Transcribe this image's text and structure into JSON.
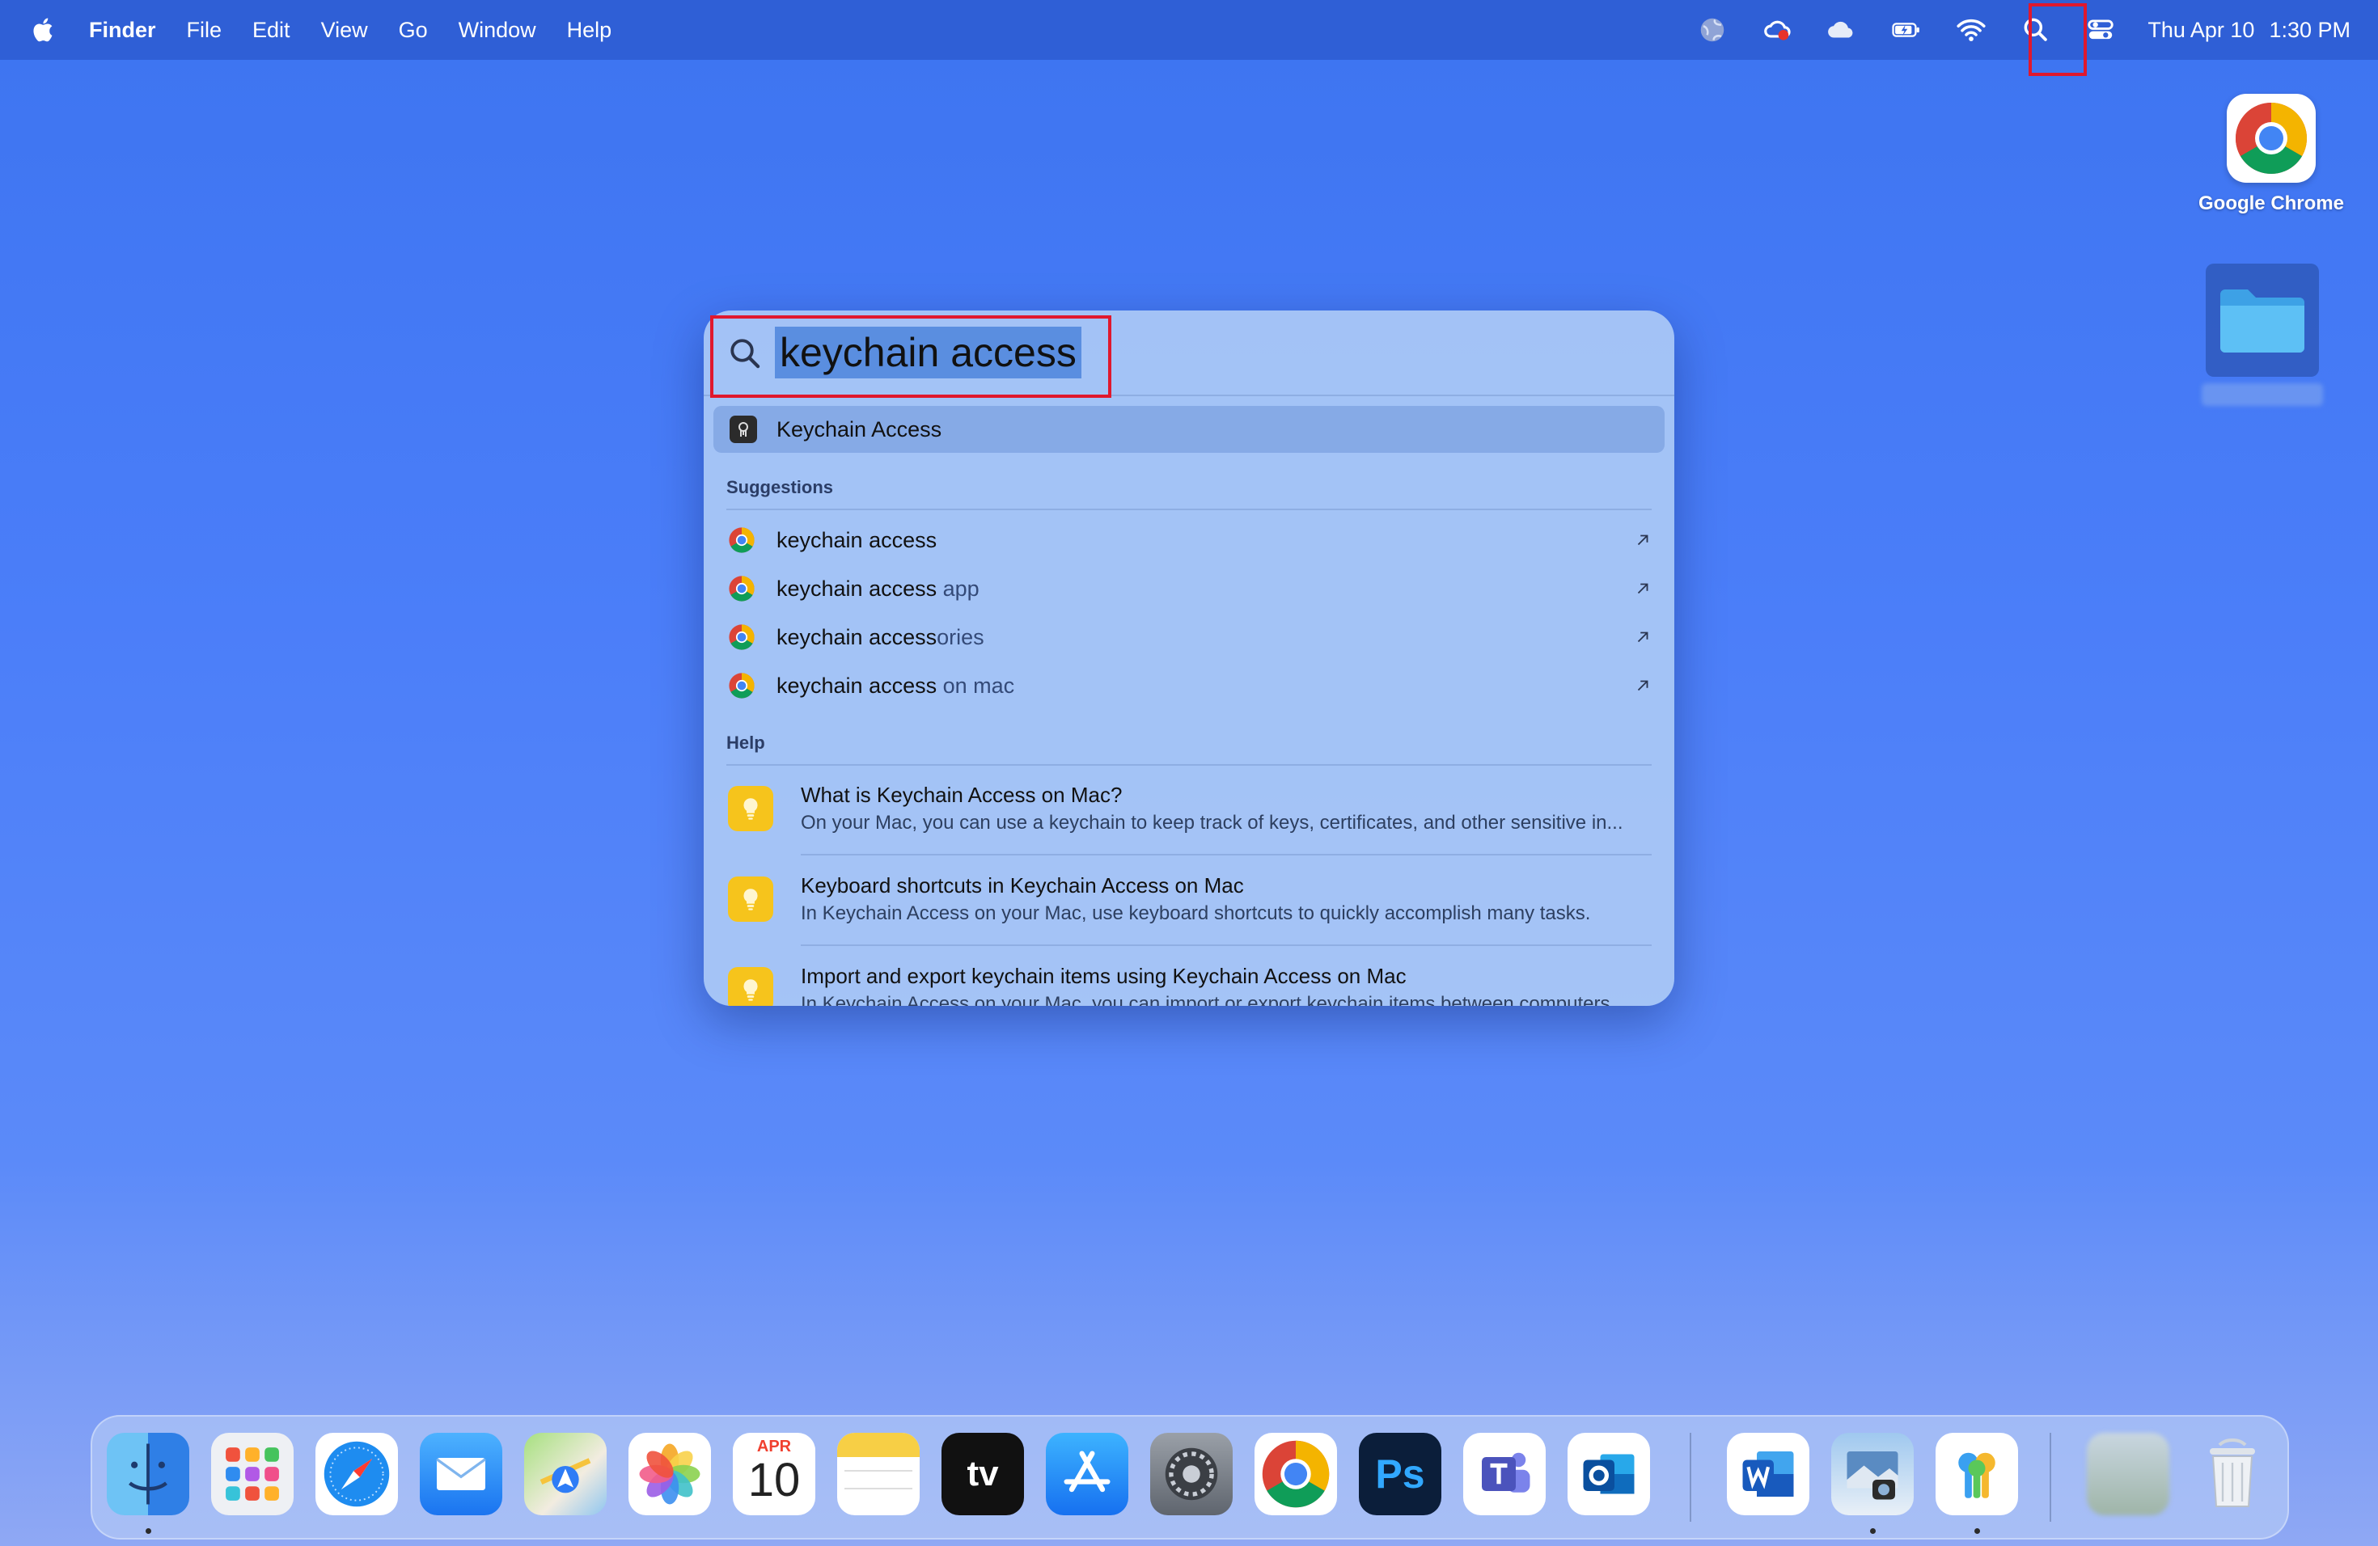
{
  "menubar": {
    "app_name": "Finder",
    "menus": [
      "File",
      "Edit",
      "View",
      "Go",
      "Window",
      "Help"
    ],
    "clock_day": "Thu Apr 10",
    "clock_time": "1:30 PM"
  },
  "desktop": {
    "chrome_label": "Google Chrome"
  },
  "spotlight": {
    "query": "keychain access",
    "top_hit": "Keychain Access",
    "suggestions_header": "Suggestions",
    "suggestions": [
      {
        "typed": "keychain access",
        "completion": ""
      },
      {
        "typed": "keychain access",
        "completion": " app"
      },
      {
        "typed": "keychain access",
        "completion": "ories"
      },
      {
        "typed": "keychain access",
        "completion": " on mac"
      }
    ],
    "help_header": "Help",
    "help": [
      {
        "title": "What is Keychain Access on Mac?",
        "subtitle": "On your Mac, you can use a keychain to keep track of keys, certificates, and other sensitive in..."
      },
      {
        "title": "Keyboard shortcuts in Keychain Access on Mac",
        "subtitle": "In Keychain Access on your Mac, use keyboard shortcuts to quickly accomplish many tasks."
      },
      {
        "title": "Import and export keychain items using Keychain Access on Mac",
        "subtitle": "In Keychain Access on your Mac, you can import or export keychain items between computers."
      }
    ]
  },
  "dock": {
    "calendar_month": "APR",
    "calendar_day": "10",
    "apps": [
      "finder-icon",
      "launchpad-icon",
      "safari-icon",
      "mail-icon",
      "maps-icon",
      "photos-icon",
      "calendar-icon",
      "notes-icon",
      "apple-tv-icon",
      "app-store-icon",
      "system-settings-icon",
      "chrome-icon",
      "photoshop-icon",
      "teams-icon",
      "outlook-icon",
      "word-icon",
      "preview-icon",
      "keychain-icon",
      "blurred-app-icon",
      "trash-icon"
    ]
  },
  "colors": {
    "highlight_box": "#e0182d",
    "menubar_bg": "#2f5fd6",
    "selection": "#5a8ee0"
  }
}
